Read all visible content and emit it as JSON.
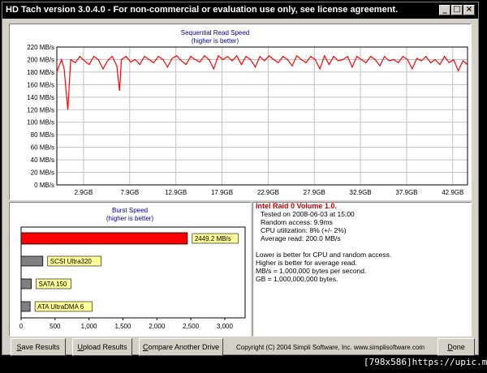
{
  "window": {
    "title": "HD Tach version 3.0.4.0  - For non-commercial or evaluation use only, see license agreement.",
    "minimize_glyph": "_",
    "maximize_glyph": "□",
    "close_glyph": "×"
  },
  "read_chart": {
    "title": "Sequential Read Speed",
    "subtitle": "(higher is better)"
  },
  "burst_chart": {
    "title": "Burst Speed",
    "subtitle": "(higher is better)"
  },
  "chart_data": [
    {
      "type": "line",
      "title": "Sequential Read Speed",
      "subtitle": "(higher is better)",
      "y_ticks": [
        "0 MB/s",
        "20 MB/s",
        "40 MB/s",
        "60 MB/s",
        "80 MB/s",
        "100 MB/s",
        "120 MB/s",
        "140 MB/s",
        "160 MB/s",
        "180 MB/s",
        "200 MB/s",
        "220 MB/s"
      ],
      "x_ticks": [
        "2.9GB",
        "7.9GB",
        "12.9GB",
        "17.9GB",
        "22.9GB",
        "27.9GB",
        "32.9GB",
        "37.9GB",
        "42.9GB"
      ],
      "ylim": [
        0,
        220
      ],
      "xlim": [
        0,
        44.5
      ],
      "grid": true,
      "color": "#ff0000",
      "series": [
        {
          "x": [
            0,
            0.5,
            0.8,
            1.0,
            1.2,
            1.5,
            2.0,
            2.5,
            3.0,
            3.5,
            4.0,
            4.5,
            5.0,
            5.5,
            6.0,
            6.5,
            6.8,
            7.0,
            7.5,
            8.0,
            8.5,
            9.0,
            9.5,
            10.0,
            10.5,
            11.0,
            11.5,
            12.0,
            12.5,
            13.0,
            13.5,
            14.0,
            14.5,
            15.0,
            15.5,
            16.0,
            16.5,
            17.0,
            17.5,
            18.0,
            18.5,
            19.0,
            19.5,
            20.0,
            20.5,
            21.0,
            21.5,
            22.0,
            22.5,
            23.0,
            23.5,
            24.0,
            24.5,
            25.0,
            25.5,
            26.0,
            26.5,
            27.0,
            27.5,
            28.0,
            28.5,
            29.0,
            29.5,
            30.0,
            30.5,
            31.0,
            31.5,
            32.0,
            32.5,
            33.0,
            33.5,
            34.0,
            34.5,
            35.0,
            35.5,
            36.0,
            36.5,
            37.0,
            37.5,
            38.0,
            38.5,
            39.0,
            39.5,
            40.0,
            40.5,
            41.0,
            41.5,
            42.0,
            42.5,
            43.0,
            43.5,
            44.0,
            44.5
          ],
          "y": [
            180,
            200,
            185,
            150,
            120,
            200,
            195,
            205,
            198,
            192,
            205,
            200,
            185,
            198,
            205,
            190,
            150,
            200,
            205,
            196,
            200,
            192,
            205,
            200,
            195,
            205,
            200,
            188,
            202,
            206,
            198,
            192,
            205,
            200,
            196,
            206,
            200,
            185,
            206,
            200,
            205,
            198,
            206,
            192,
            205,
            200,
            188,
            205,
            198,
            206,
            200,
            195,
            205,
            200,
            190,
            206,
            200,
            195,
            205,
            200,
            185,
            206,
            192,
            205,
            198,
            200,
            205,
            188,
            205,
            200,
            195,
            205,
            200,
            190,
            205,
            198,
            200,
            195,
            205,
            200,
            185,
            202,
            198,
            205,
            195,
            200,
            192,
            205,
            195,
            200,
            182,
            198,
            192
          ]
        }
      ]
    },
    {
      "type": "bar",
      "title": "Burst Speed",
      "subtitle": "(higher is better)",
      "orientation": "horizontal",
      "xlim": [
        0,
        3300
      ],
      "x_ticks": [
        "0",
        "500",
        "1,000",
        "1,500",
        "2,000",
        "2,500",
        "3,000"
      ],
      "categories": [
        "2449.2 MB/s",
        "SCSI Ultra320",
        "SATA 150",
        "ATA UltraDMA 6"
      ],
      "values": [
        2449.2,
        320,
        150,
        133
      ],
      "colors": [
        "#ff0000",
        "#808080",
        "#808080",
        "#808080"
      ]
    }
  ],
  "info": {
    "title": "Intel Raid 0 Volume 1.0.",
    "tested": "Tested on 2008-06-03 at 15:00",
    "random_access": "Random access: 9.9ms",
    "cpu": "CPU utilization: 8% (+/- 2%)",
    "average": "Average read: 200.0 MB/s",
    "note1": "Lower is better for CPU and random access.",
    "note2": "Higher is better for average read.",
    "note3": "MB/s = 1,000,000 bytes per second.",
    "note4": "GB = 1,000,000,000 bytes."
  },
  "buttons": {
    "save_hot": "S",
    "save_rest": "ave Results",
    "upload_hot": "U",
    "upload_rest": "pload Results",
    "compare_hot": "C",
    "compare_rest": "ompare Another Drive",
    "done_hot": "D",
    "done_rest": "one"
  },
  "copyright": "Copyright (C) 2004 Simpli Software, Inc. www.simplisoftware.com",
  "watermark": "[798x586]https://upic.me/"
}
